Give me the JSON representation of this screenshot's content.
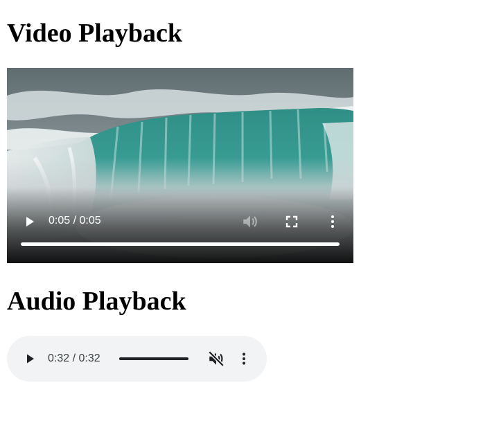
{
  "video_section": {
    "title": "Video Playback",
    "player": {
      "time_display": "0:05 / 0:05",
      "progress_fraction": 1.0,
      "muted_state": "disabled",
      "play_icon": "play-icon",
      "volume_icon": "volume-icon",
      "fullscreen_icon": "fullscreen-icon",
      "more_icon": "more-vertical-icon"
    }
  },
  "audio_section": {
    "title": "Audio Playback",
    "player": {
      "time_display": "0:32 / 0:32",
      "progress_fraction": 1.0,
      "muted": true,
      "play_icon": "play-icon",
      "volume_icon": "volume-muted-icon",
      "more_icon": "more-vertical-icon"
    }
  },
  "colors": {
    "audio_player_bg": "#f1f3f4",
    "audio_icon": "#202124",
    "video_control_icon": "#ffffff"
  }
}
